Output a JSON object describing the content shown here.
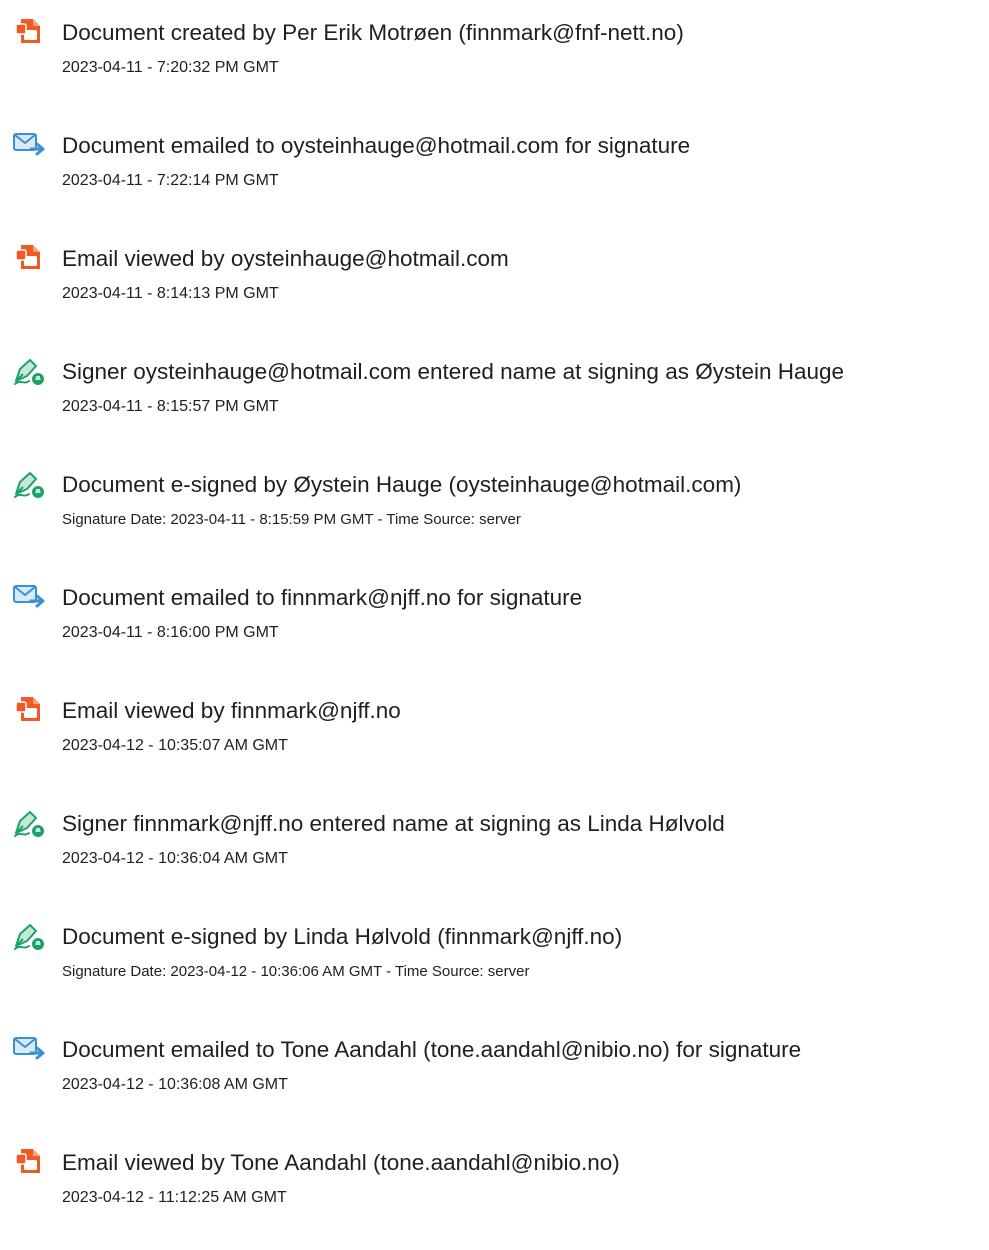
{
  "colors": {
    "document_icon": "#f15a24",
    "email_icon_blue": "#3d8fd6",
    "sign_icon_green": "#1ba36b",
    "text": "#1f1f1f"
  },
  "events": [
    {
      "icon": "document-icon",
      "title": "Document created by Per Erik Motrøen (finnmark@fnf-nett.no)",
      "subtitle": "2023-04-11 - 7:20:32 PM GMT"
    },
    {
      "icon": "email-icon",
      "title": "Document emailed to oysteinhauge@hotmail.com for signature",
      "subtitle": "2023-04-11 - 7:22:14 PM GMT"
    },
    {
      "icon": "document-icon",
      "title": "Email viewed by oysteinhauge@hotmail.com",
      "subtitle": "2023-04-11 - 8:14:13 PM GMT"
    },
    {
      "icon": "signature-icon",
      "title": "Signer oysteinhauge@hotmail.com entered name at signing as Øystein Hauge",
      "subtitle": "2023-04-11 - 8:15:57 PM GMT"
    },
    {
      "icon": "signature-icon",
      "title": "Document e-signed by Øystein Hauge (oysteinhauge@hotmail.com)",
      "subtitle": "Signature Date: 2023-04-11 - 8:15:59 PM GMT - Time Source: server"
    },
    {
      "icon": "email-icon",
      "title": "Document emailed to finnmark@njff.no for signature",
      "subtitle": "2023-04-11 - 8:16:00 PM GMT"
    },
    {
      "icon": "document-icon",
      "title": "Email viewed by finnmark@njff.no",
      "subtitle": "2023-04-12 - 10:35:07 AM GMT"
    },
    {
      "icon": "signature-icon",
      "title": "Signer finnmark@njff.no entered name at signing as Linda Hølvold",
      "subtitle": "2023-04-12 - 10:36:04 AM GMT"
    },
    {
      "icon": "signature-icon",
      "title": "Document e-signed by Linda Hølvold (finnmark@njff.no)",
      "subtitle": "Signature Date: 2023-04-12 - 10:36:06 AM GMT - Time Source: server"
    },
    {
      "icon": "email-icon",
      "title": "Document emailed to Tone Aandahl (tone.aandahl@nibio.no) for signature",
      "subtitle": "2023-04-12 - 10:36:08 AM GMT"
    },
    {
      "icon": "document-icon",
      "title": "Email viewed by Tone Aandahl (tone.aandahl@nibio.no)",
      "subtitle": "2023-04-12 - 11:12:25 AM GMT"
    }
  ]
}
